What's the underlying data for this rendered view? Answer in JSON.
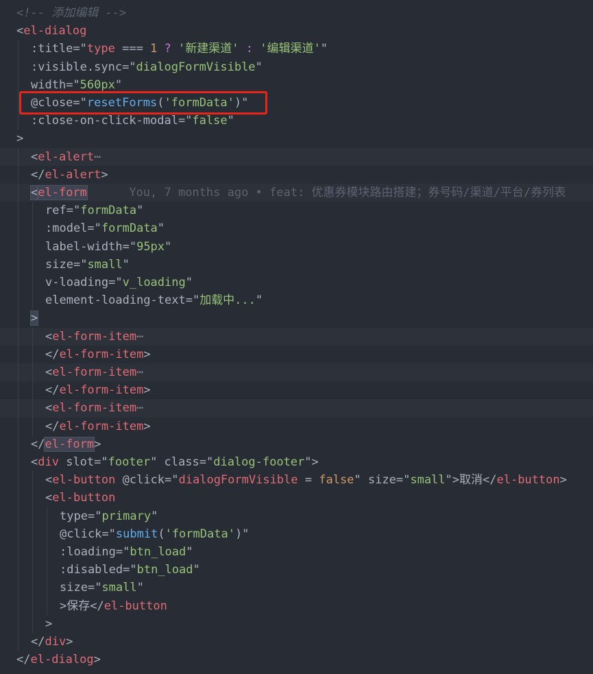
{
  "lines": [
    {
      "indent": 0,
      "tokens": [
        {
          "t": "<!-- 添加编辑 -->",
          "c": "comment"
        }
      ]
    },
    {
      "indent": 0,
      "tokens": [
        {
          "t": "<",
          "c": "plain"
        },
        {
          "t": "el-dialog",
          "c": "tag"
        }
      ]
    },
    {
      "indent": 1,
      "tokens": [
        {
          "t": ":title",
          "c": "attr"
        },
        {
          "t": "=\"",
          "c": "plain"
        },
        {
          "t": "type",
          "c": "tag"
        },
        {
          "t": " === ",
          "c": "plain"
        },
        {
          "t": "1",
          "c": "num"
        },
        {
          "t": " ? ",
          "c": "kw"
        },
        {
          "t": "'新建渠道'",
          "c": "str"
        },
        {
          "t": " : ",
          "c": "kw"
        },
        {
          "t": "'编辑渠道'",
          "c": "str"
        },
        {
          "t": "\"",
          "c": "plain"
        }
      ]
    },
    {
      "indent": 1,
      "tokens": [
        {
          "t": ":visible.sync",
          "c": "attr"
        },
        {
          "t": "=\"",
          "c": "plain"
        },
        {
          "t": "dialogFormVisible",
          "c": "str"
        },
        {
          "t": "\"",
          "c": "plain"
        }
      ]
    },
    {
      "indent": 1,
      "tokens": [
        {
          "t": "width",
          "c": "attr"
        },
        {
          "t": "=\"",
          "c": "plain"
        },
        {
          "t": "560px",
          "c": "str"
        },
        {
          "t": "\"",
          "c": "plain"
        }
      ]
    },
    {
      "indent": 1,
      "tokens": [
        {
          "t": "@close",
          "c": "attr"
        },
        {
          "t": "=\"",
          "c": "plain"
        },
        {
          "t": "resetForms",
          "c": "fn"
        },
        {
          "t": "(",
          "c": "plain"
        },
        {
          "t": "'formData'",
          "c": "str"
        },
        {
          "t": ")\"",
          "c": "plain"
        }
      ]
    },
    {
      "indent": 1,
      "tokens": [
        {
          "t": ":close-on-click-modal",
          "c": "attr"
        },
        {
          "t": "=\"",
          "c": "plain"
        },
        {
          "t": "false",
          "c": "str"
        },
        {
          "t": "\"",
          "c": "plain"
        }
      ]
    },
    {
      "indent": 0,
      "tokens": [
        {
          "t": ">",
          "c": "plain"
        }
      ]
    },
    {
      "indent": 1,
      "hl": true,
      "tokens": [
        {
          "t": "<",
          "c": "plain"
        },
        {
          "t": "el-alert",
          "c": "tag"
        },
        {
          "t": "⋯",
          "c": "fold"
        }
      ]
    },
    {
      "indent": 1,
      "tokens": [
        {
          "t": "</",
          "c": "plain"
        },
        {
          "t": "el-alert",
          "c": "tag"
        },
        {
          "t": ">",
          "c": "plain"
        }
      ]
    },
    {
      "indent": 1,
      "hl": true,
      "tokens": [
        {
          "t": "<",
          "c": "bracketsel"
        },
        {
          "t": "el-form",
          "c": "tagsel"
        },
        {
          "t": "      You, 7 months ago • feat: 优惠券模块路由搭建；券号码/渠道/平台/券列表",
          "c": "blame"
        }
      ]
    },
    {
      "indent": 2,
      "tokens": [
        {
          "t": "ref",
          "c": "attr"
        },
        {
          "t": "=\"",
          "c": "plain"
        },
        {
          "t": "formData",
          "c": "str"
        },
        {
          "t": "\"",
          "c": "plain"
        }
      ]
    },
    {
      "indent": 2,
      "tokens": [
        {
          "t": ":model",
          "c": "attr"
        },
        {
          "t": "=\"",
          "c": "plain"
        },
        {
          "t": "formData",
          "c": "str"
        },
        {
          "t": "\"",
          "c": "plain"
        }
      ]
    },
    {
      "indent": 2,
      "tokens": [
        {
          "t": "label-width",
          "c": "attr"
        },
        {
          "t": "=\"",
          "c": "plain"
        },
        {
          "t": "95px",
          "c": "str"
        },
        {
          "t": "\"",
          "c": "plain"
        }
      ]
    },
    {
      "indent": 2,
      "tokens": [
        {
          "t": "size",
          "c": "attr"
        },
        {
          "t": "=\"",
          "c": "plain"
        },
        {
          "t": "small",
          "c": "str"
        },
        {
          "t": "\"",
          "c": "plain"
        }
      ]
    },
    {
      "indent": 2,
      "tokens": [
        {
          "t": "v-loading",
          "c": "attr"
        },
        {
          "t": "=\"",
          "c": "plain"
        },
        {
          "t": "v_loading",
          "c": "str"
        },
        {
          "t": "\"",
          "c": "plain"
        }
      ]
    },
    {
      "indent": 2,
      "tokens": [
        {
          "t": "element-loading-text",
          "c": "attr"
        },
        {
          "t": "=\"",
          "c": "plain"
        },
        {
          "t": "加载中...",
          "c": "str"
        },
        {
          "t": "\"",
          "c": "plain"
        }
      ]
    },
    {
      "indent": 1,
      "tokens": [
        {
          "t": ">",
          "c": "bracketsel"
        }
      ]
    },
    {
      "indent": 2,
      "hl": true,
      "tokens": [
        {
          "t": "<",
          "c": "plain"
        },
        {
          "t": "el-form-item",
          "c": "tag"
        },
        {
          "t": "⋯",
          "c": "fold"
        }
      ]
    },
    {
      "indent": 2,
      "tokens": [
        {
          "t": "</",
          "c": "plain"
        },
        {
          "t": "el-form-item",
          "c": "tag"
        },
        {
          "t": ">",
          "c": "plain"
        }
      ]
    },
    {
      "indent": 2,
      "hl": true,
      "tokens": [
        {
          "t": "<",
          "c": "plain"
        },
        {
          "t": "el-form-item",
          "c": "tag"
        },
        {
          "t": "⋯",
          "c": "fold"
        }
      ]
    },
    {
      "indent": 2,
      "tokens": [
        {
          "t": "</",
          "c": "plain"
        },
        {
          "t": "el-form-item",
          "c": "tag"
        },
        {
          "t": ">",
          "c": "plain"
        }
      ]
    },
    {
      "indent": 2,
      "hl": true,
      "tokens": [
        {
          "t": "<",
          "c": "plain"
        },
        {
          "t": "el-form-item",
          "c": "tag"
        },
        {
          "t": "⋯",
          "c": "fold"
        }
      ]
    },
    {
      "indent": 2,
      "tokens": [
        {
          "t": "</",
          "c": "plain"
        },
        {
          "t": "el-form-item",
          "c": "tag"
        },
        {
          "t": ">",
          "c": "plain"
        }
      ]
    },
    {
      "indent": 1,
      "tokens": [
        {
          "t": "</",
          "c": "plain"
        },
        {
          "t": "el-form",
          "c": "tagsel"
        },
        {
          "t": ">",
          "c": "plain"
        }
      ]
    },
    {
      "indent": 1,
      "tokens": [
        {
          "t": "<",
          "c": "plain"
        },
        {
          "t": "div",
          "c": "tag"
        },
        {
          "t": " slot",
          "c": "attr"
        },
        {
          "t": "=\"",
          "c": "plain"
        },
        {
          "t": "footer",
          "c": "str"
        },
        {
          "t": "\"",
          "c": "plain"
        },
        {
          "t": " class",
          "c": "attr"
        },
        {
          "t": "=\"",
          "c": "plain"
        },
        {
          "t": "dialog-footer",
          "c": "str"
        },
        {
          "t": "\">",
          "c": "plain"
        }
      ]
    },
    {
      "indent": 2,
      "tokens": [
        {
          "t": "<",
          "c": "plain"
        },
        {
          "t": "el-button",
          "c": "tag"
        },
        {
          "t": " @click",
          "c": "attr"
        },
        {
          "t": "=\"",
          "c": "plain"
        },
        {
          "t": "dialogFormVisible",
          "c": "tag"
        },
        {
          "t": " = ",
          "c": "plain"
        },
        {
          "t": "false",
          "c": "num"
        },
        {
          "t": "\"",
          "c": "plain"
        },
        {
          "t": " size",
          "c": "attr"
        },
        {
          "t": "=\"",
          "c": "plain"
        },
        {
          "t": "small",
          "c": "str"
        },
        {
          "t": "\">取消</",
          "c": "plain"
        },
        {
          "t": "el-button",
          "c": "tag"
        },
        {
          "t": ">",
          "c": "plain"
        }
      ]
    },
    {
      "indent": 2,
      "tokens": [
        {
          "t": "<",
          "c": "plain"
        },
        {
          "t": "el-button",
          "c": "tag"
        }
      ]
    },
    {
      "indent": 3,
      "tokens": [
        {
          "t": "type",
          "c": "attr"
        },
        {
          "t": "=\"",
          "c": "plain"
        },
        {
          "t": "primary",
          "c": "str"
        },
        {
          "t": "\"",
          "c": "plain"
        }
      ]
    },
    {
      "indent": 3,
      "tokens": [
        {
          "t": "@click",
          "c": "attr"
        },
        {
          "t": "=\"",
          "c": "plain"
        },
        {
          "t": "submit",
          "c": "fn"
        },
        {
          "t": "(",
          "c": "plain"
        },
        {
          "t": "'formData'",
          "c": "str"
        },
        {
          "t": ")\"",
          "c": "plain"
        }
      ]
    },
    {
      "indent": 3,
      "tokens": [
        {
          "t": ":loading",
          "c": "attr"
        },
        {
          "t": "=\"",
          "c": "plain"
        },
        {
          "t": "btn_load",
          "c": "str"
        },
        {
          "t": "\"",
          "c": "plain"
        }
      ]
    },
    {
      "indent": 3,
      "tokens": [
        {
          "t": ":disabled",
          "c": "attr"
        },
        {
          "t": "=\"",
          "c": "plain"
        },
        {
          "t": "btn_load",
          "c": "str"
        },
        {
          "t": "\"",
          "c": "plain"
        }
      ]
    },
    {
      "indent": 3,
      "tokens": [
        {
          "t": "size",
          "c": "attr"
        },
        {
          "t": "=\"",
          "c": "plain"
        },
        {
          "t": "small",
          "c": "str"
        },
        {
          "t": "\"",
          "c": "plain"
        }
      ]
    },
    {
      "indent": 3,
      "tokens": [
        {
          "t": ">保存</",
          "c": "plain"
        },
        {
          "t": "el-button",
          "c": "tag"
        }
      ]
    },
    {
      "indent": 2,
      "tokens": [
        {
          "t": ">",
          "c": "plain"
        }
      ]
    },
    {
      "indent": 1,
      "tokens": [
        {
          "t": "</",
          "c": "plain"
        },
        {
          "t": "div",
          "c": "tag"
        },
        {
          "t": ">",
          "c": "plain"
        }
      ]
    },
    {
      "indent": 0,
      "tokens": [
        {
          "t": "</",
          "c": "plain"
        },
        {
          "t": "el-dialog",
          "c": "tag"
        },
        {
          "t": ">",
          "c": "plain"
        }
      ]
    }
  ],
  "colors": {
    "background": "#282c34",
    "highlight_box": "#e8261c",
    "tag": "#e06c75",
    "string": "#98c379",
    "function": "#61afef",
    "keyword": "#c678dd",
    "number": "#d19a66",
    "comment": "#5c6370"
  }
}
